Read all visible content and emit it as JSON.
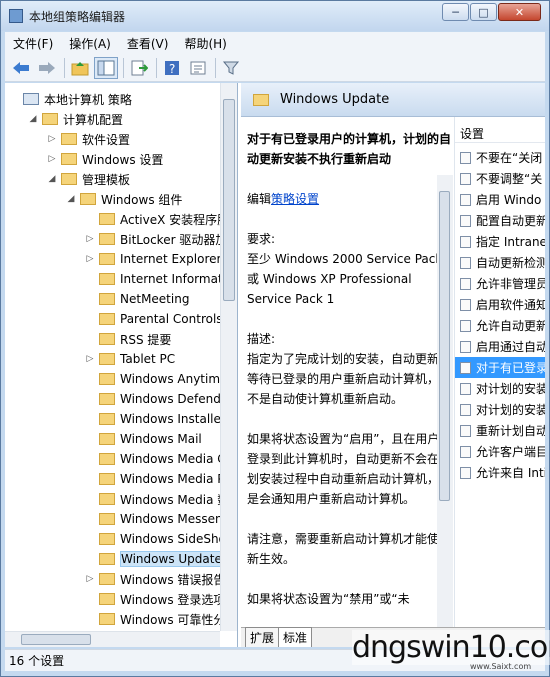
{
  "window": {
    "title": "本地组策略编辑器",
    "min": "─",
    "max": "□",
    "close": "✕"
  },
  "menu": [
    "文件(F)",
    "操作(A)",
    "查看(V)",
    "帮助(H)"
  ],
  "toolbar": {
    "icons": [
      "back-arrow-icon",
      "forward-arrow-icon",
      "up-folder-icon",
      "show-hide-tree-icon",
      "export-list-icon",
      "help-icon",
      "properties-icon",
      "filter-icon"
    ]
  },
  "tree": [
    {
      "label": "本地计算机 策略",
      "level": 0,
      "expand": ""
    },
    {
      "label": "计算机配置",
      "level": 1,
      "expand": "◢"
    },
    {
      "label": "软件设置",
      "level": 2,
      "expand": "▷"
    },
    {
      "label": "Windows 设置",
      "level": 2,
      "expand": "▷"
    },
    {
      "label": "管理模板",
      "level": 2,
      "expand": "◢"
    },
    {
      "label": "Windows 组件",
      "level": 3,
      "expand": "◢"
    },
    {
      "label": "ActiveX 安装程序服",
      "level": 4,
      "expand": ""
    },
    {
      "label": "BitLocker 驱动器加",
      "level": 4,
      "expand": "▷"
    },
    {
      "label": "Internet Explorer",
      "level": 4,
      "expand": "▷"
    },
    {
      "label": "Internet Informatio",
      "level": 4,
      "expand": ""
    },
    {
      "label": "NetMeeting",
      "level": 4,
      "expand": ""
    },
    {
      "label": "Parental Controls",
      "level": 4,
      "expand": ""
    },
    {
      "label": "RSS 提要",
      "level": 4,
      "expand": ""
    },
    {
      "label": "Tablet PC",
      "level": 4,
      "expand": "▷"
    },
    {
      "label": "Windows Anytime",
      "level": 4,
      "expand": ""
    },
    {
      "label": "Windows Defende",
      "level": 4,
      "expand": ""
    },
    {
      "label": "Windows Installer",
      "level": 4,
      "expand": ""
    },
    {
      "label": "Windows Mail",
      "level": 4,
      "expand": ""
    },
    {
      "label": "Windows Media C",
      "level": 4,
      "expand": ""
    },
    {
      "label": "Windows Media Pl",
      "level": 4,
      "expand": ""
    },
    {
      "label": "Windows Media 数",
      "level": 4,
      "expand": ""
    },
    {
      "label": "Windows Messeng",
      "level": 4,
      "expand": ""
    },
    {
      "label": "Windows SideShov",
      "level": 4,
      "expand": ""
    },
    {
      "label": "Windows Update",
      "level": 4,
      "expand": "",
      "selected": true
    },
    {
      "label": "Windows 错误报告",
      "level": 4,
      "expand": "▷"
    },
    {
      "label": "Windows 登录选项",
      "level": 4,
      "expand": ""
    },
    {
      "label": "Windows 可靠性分",
      "level": 4,
      "expand": ""
    }
  ],
  "pane": {
    "title": "Windows Update"
  },
  "desc": {
    "heading": "对于有已登录用户的计算机，计划的自动更新安装不执行重新启动",
    "edit_prefix": "编辑",
    "edit_link": "策略设置",
    "req_label": "要求:",
    "req_text": "至少 Windows 2000 Service Pack 3 或 Windows XP Professional Service Pack 1",
    "desc_label": "描述:",
    "desc_text": "指定为了完成计划的安装，自动更新将等待已登录的用户重新启动计算机，而不是自动使计算机重新启动。",
    "p2": "如果将状态设置为“启用”，且在用户已登录到此计算机时，自动更新不会在计划安装过程中自动重新启动计算机，而是会通知用户重新启动计算机。",
    "p3": "请注意，需要重新启动计算机才能使更新生效。",
    "p4": "如果将状态设置为“禁用”或“未"
  },
  "settings": {
    "header": "设置",
    "items": [
      {
        "label": "不要在“关闭"
      },
      {
        "label": "不要调整“关"
      },
      {
        "label": "启用 Windo"
      },
      {
        "label": "配置自动更新"
      },
      {
        "label": "指定 Intrane"
      },
      {
        "label": "自动更新检测"
      },
      {
        "label": "允许非管理员"
      },
      {
        "label": "启用软件通知"
      },
      {
        "label": "允许自动更新"
      },
      {
        "label": "启用通过自动"
      },
      {
        "label": "对于有已登录",
        "selected": true
      },
      {
        "label": "对计划的安装"
      },
      {
        "label": "对计划的安装"
      },
      {
        "label": "重新计划自动"
      },
      {
        "label": "允许客户端目"
      },
      {
        "label": "允许来自 Inti"
      }
    ]
  },
  "tabs": [
    "扩展",
    "标准"
  ],
  "status": "16 个设置",
  "watermark": {
    "main": "dngswin10.com",
    "sub": "www.Saixt.com"
  }
}
